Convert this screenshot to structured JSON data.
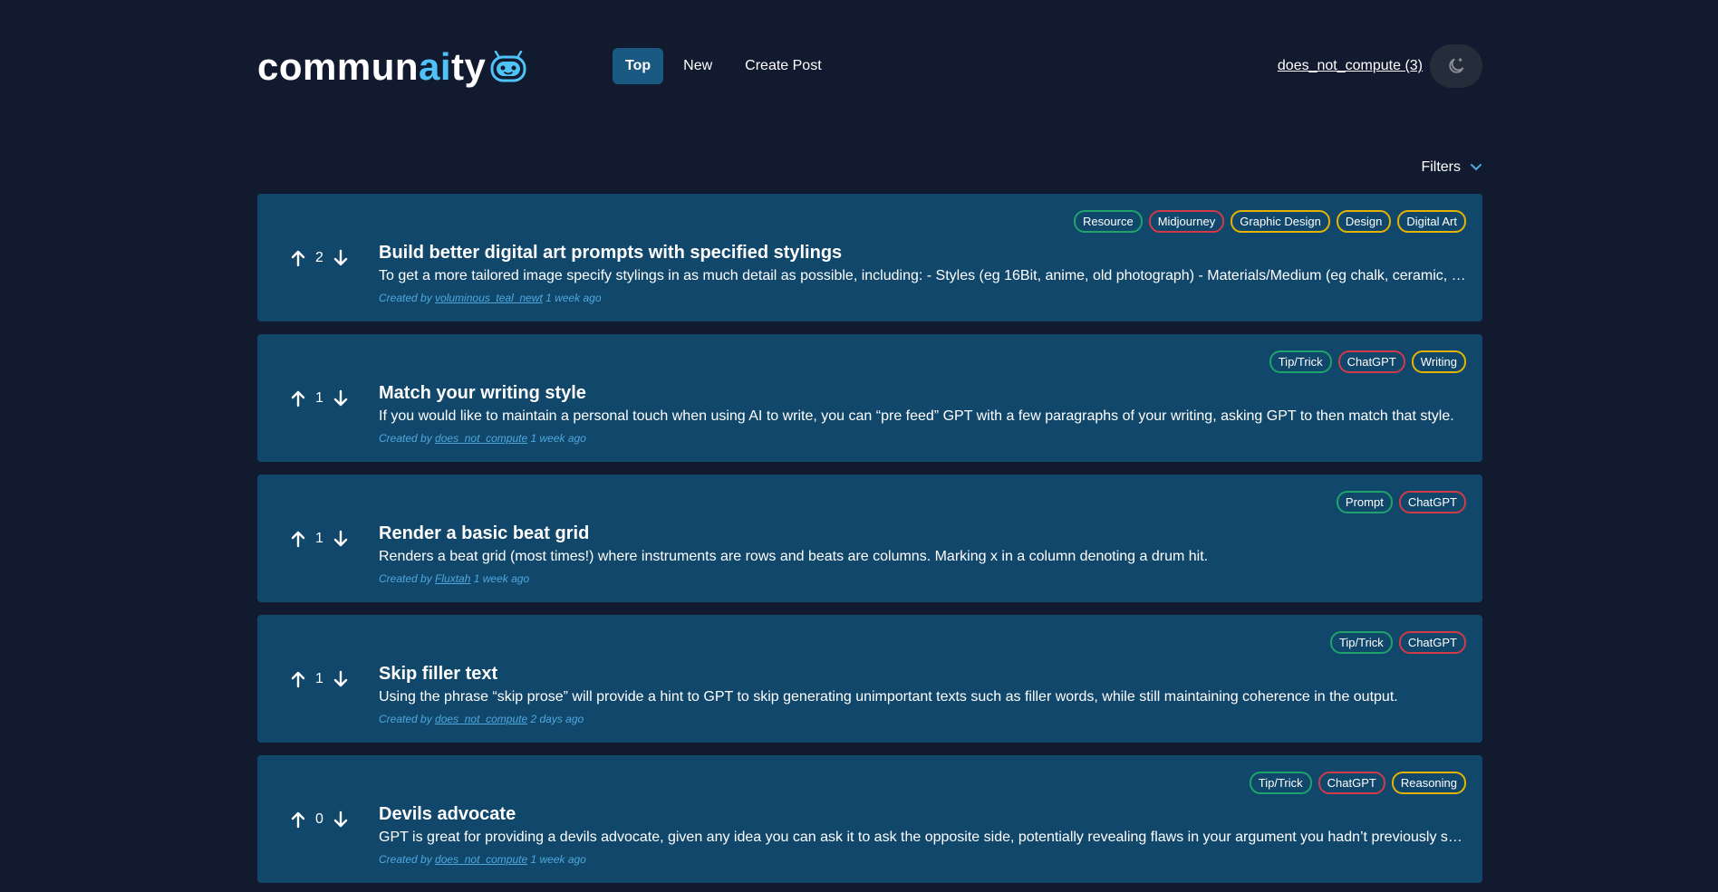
{
  "brand": {
    "name_prefix": "commun",
    "name_ai": "ai",
    "name_suffix": "ty",
    "accent": "#4fc3f7"
  },
  "nav": {
    "items": [
      {
        "label": "Top",
        "active": true
      },
      {
        "label": "New",
        "active": false
      },
      {
        "label": "Create Post",
        "active": false
      }
    ]
  },
  "user": {
    "label": "does_not_compute (3)"
  },
  "theme_toggle": {
    "icon": "moon-icon"
  },
  "filters": {
    "label": "Filters",
    "icon": "chevron-down-icon"
  },
  "posts": [
    {
      "votes": "2",
      "title": "Build better digital art prompts with specified stylings",
      "description": "To get a more tailored image specify stylings in as much detail as possible, including: - Styles (eg 16Bit, anime, old photograph) - Materials/Medium (eg chalk, ceramic, plastic...",
      "created_prefix": "Created by ",
      "author": "voluminous_teal_newt",
      "time": "1 week ago",
      "tags": [
        {
          "label": "Resource",
          "color": "green"
        },
        {
          "label": "Midjourney",
          "color": "red"
        },
        {
          "label": "Graphic Design",
          "color": "yellow"
        },
        {
          "label": "Design",
          "color": "yellow"
        },
        {
          "label": "Digital Art",
          "color": "yellow"
        }
      ]
    },
    {
      "votes": "1",
      "title": "Match your writing style",
      "description": "If you would like to maintain a personal touch when using AI to write, you can “pre feed” GPT with a few paragraphs of your writing, asking GPT to then match that style.",
      "created_prefix": "Created by ",
      "author": "does_not_compute",
      "time": "1 week ago",
      "tags": [
        {
          "label": "Tip/Trick",
          "color": "green"
        },
        {
          "label": "ChatGPT",
          "color": "red"
        },
        {
          "label": "Writing",
          "color": "yellow"
        }
      ]
    },
    {
      "votes": "1",
      "title": "Render a basic beat grid",
      "description": "Renders a beat grid (most times!) where instruments are rows and beats are columns. Marking x in a column denoting a drum hit.",
      "created_prefix": "Created by ",
      "author": "Fluxtah",
      "time": "1 week ago",
      "tags": [
        {
          "label": "Prompt",
          "color": "green"
        },
        {
          "label": "ChatGPT",
          "color": "red"
        }
      ]
    },
    {
      "votes": "1",
      "title": "Skip filler text",
      "description": "Using the phrase “skip prose” will provide a hint to GPT to skip generating unimportant texts such as filler words, while still maintaining coherence in the output.",
      "created_prefix": "Created by ",
      "author": "does_not_compute",
      "time": "2 days ago",
      "tags": [
        {
          "label": "Tip/Trick",
          "color": "green"
        },
        {
          "label": "ChatGPT",
          "color": "red"
        }
      ]
    },
    {
      "votes": "0",
      "title": "Devils advocate",
      "description": "GPT is great for providing a devils advocate, given any idea you can ask it to ask the opposite side, potentially revealing flaws in your argument you hadn’t previously seen.",
      "created_prefix": "Created by ",
      "author": "does_not_compute",
      "time": "1 week ago",
      "tags": [
        {
          "label": "Tip/Trick",
          "color": "green"
        },
        {
          "label": "ChatGPT",
          "color": "red"
        },
        {
          "label": "Reasoning",
          "color": "yellow"
        }
      ]
    }
  ],
  "colors": {
    "background": "#111a2e",
    "card": "#11476b",
    "nav_active": "#1a5a82",
    "meta": "#4ea8de",
    "tag_green": "#1fa36b",
    "tag_red": "#d23a48",
    "tag_yellow": "#e5b400"
  }
}
